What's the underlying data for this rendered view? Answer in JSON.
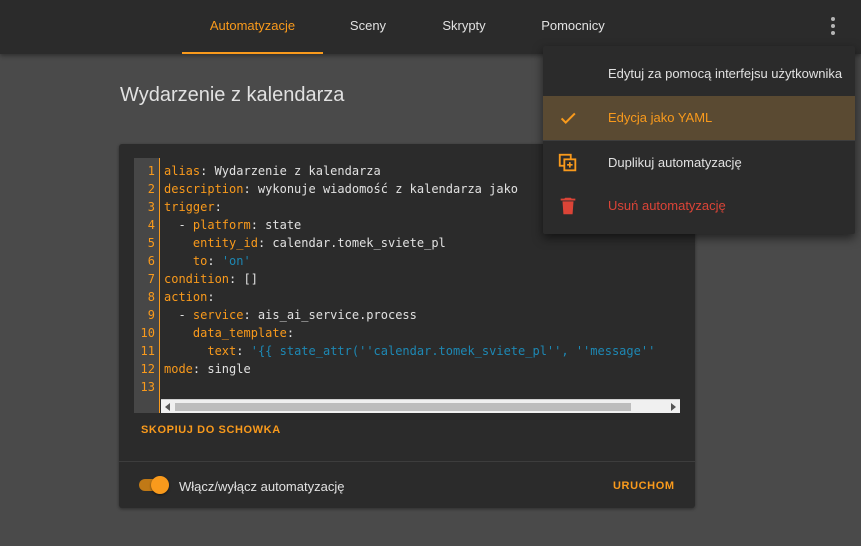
{
  "tabs": [
    {
      "label": "Automatyzacje",
      "active": true
    },
    {
      "label": "Sceny",
      "active": false
    },
    {
      "label": "Skrypty",
      "active": false
    },
    {
      "label": "Pomocnicy",
      "active": false
    }
  ],
  "page": {
    "title": "Wydarzenie z kalendarza"
  },
  "editor": {
    "line_numbers": [
      "1",
      "2",
      "3",
      "4",
      "5",
      "6",
      "7",
      "8",
      "9",
      "10",
      "11",
      "12",
      "13"
    ],
    "lines": [
      [
        {
          "c": "k",
          "v": "alias"
        },
        {
          "c": "t",
          "v": ": Wydarzenie z kalendarza"
        }
      ],
      [
        {
          "c": "k",
          "v": "description"
        },
        {
          "c": "t",
          "v": ": wykonuje wiadomość z kalendarza jako"
        }
      ],
      [
        {
          "c": "k",
          "v": "trigger"
        },
        {
          "c": "t",
          "v": ":"
        }
      ],
      [
        {
          "c": "t",
          "v": "  - "
        },
        {
          "c": "k",
          "v": "platform"
        },
        {
          "c": "t",
          "v": ": state"
        }
      ],
      [
        {
          "c": "t",
          "v": "    "
        },
        {
          "c": "k",
          "v": "entity_id"
        },
        {
          "c": "t",
          "v": ": calendar.tomek_sviete_pl"
        }
      ],
      [
        {
          "c": "t",
          "v": "    "
        },
        {
          "c": "k",
          "v": "to"
        },
        {
          "c": "t",
          "v": ": "
        },
        {
          "c": "s",
          "v": "'on'"
        }
      ],
      [
        {
          "c": "k",
          "v": "condition"
        },
        {
          "c": "t",
          "v": ": []"
        }
      ],
      [
        {
          "c": "k",
          "v": "action"
        },
        {
          "c": "t",
          "v": ":"
        }
      ],
      [
        {
          "c": "t",
          "v": "  - "
        },
        {
          "c": "k",
          "v": "service"
        },
        {
          "c": "t",
          "v": ": ais_ai_service.process"
        }
      ],
      [
        {
          "c": "t",
          "v": "    "
        },
        {
          "c": "k",
          "v": "data_template"
        },
        {
          "c": "t",
          "v": ":"
        }
      ],
      [
        {
          "c": "t",
          "v": "      "
        },
        {
          "c": "k",
          "v": "text"
        },
        {
          "c": "t",
          "v": ": "
        },
        {
          "c": "s",
          "v": "'{{ state_attr(''calendar.tomek_sviete_pl'', ''message''"
        }
      ],
      [
        {
          "c": "k",
          "v": "mode"
        },
        {
          "c": "t",
          "v": ": single"
        }
      ],
      []
    ]
  },
  "card": {
    "copy_label": "SKOPIUJ DO SCHOWKA",
    "toggle_label": "Włącz/wyłącz automatyzację",
    "toggle_on": true,
    "run_label": "URUCHOM"
  },
  "menu": {
    "items": [
      {
        "label": "Edytuj za pomocą interfejsu użytkownika",
        "icon": "none",
        "selected": false
      },
      {
        "label": "Edycja jako YAML",
        "icon": "check-icon",
        "selected": true
      },
      {
        "label": "Duplikuj automatyzację",
        "icon": "duplicate-icon",
        "selected": false
      },
      {
        "label": "Usuń automatyzację",
        "icon": "trash-icon",
        "selected": false,
        "danger": true
      }
    ]
  },
  "colors": {
    "accent": "#f99a1c",
    "danger": "#db4437",
    "string": "#1d88b4"
  }
}
